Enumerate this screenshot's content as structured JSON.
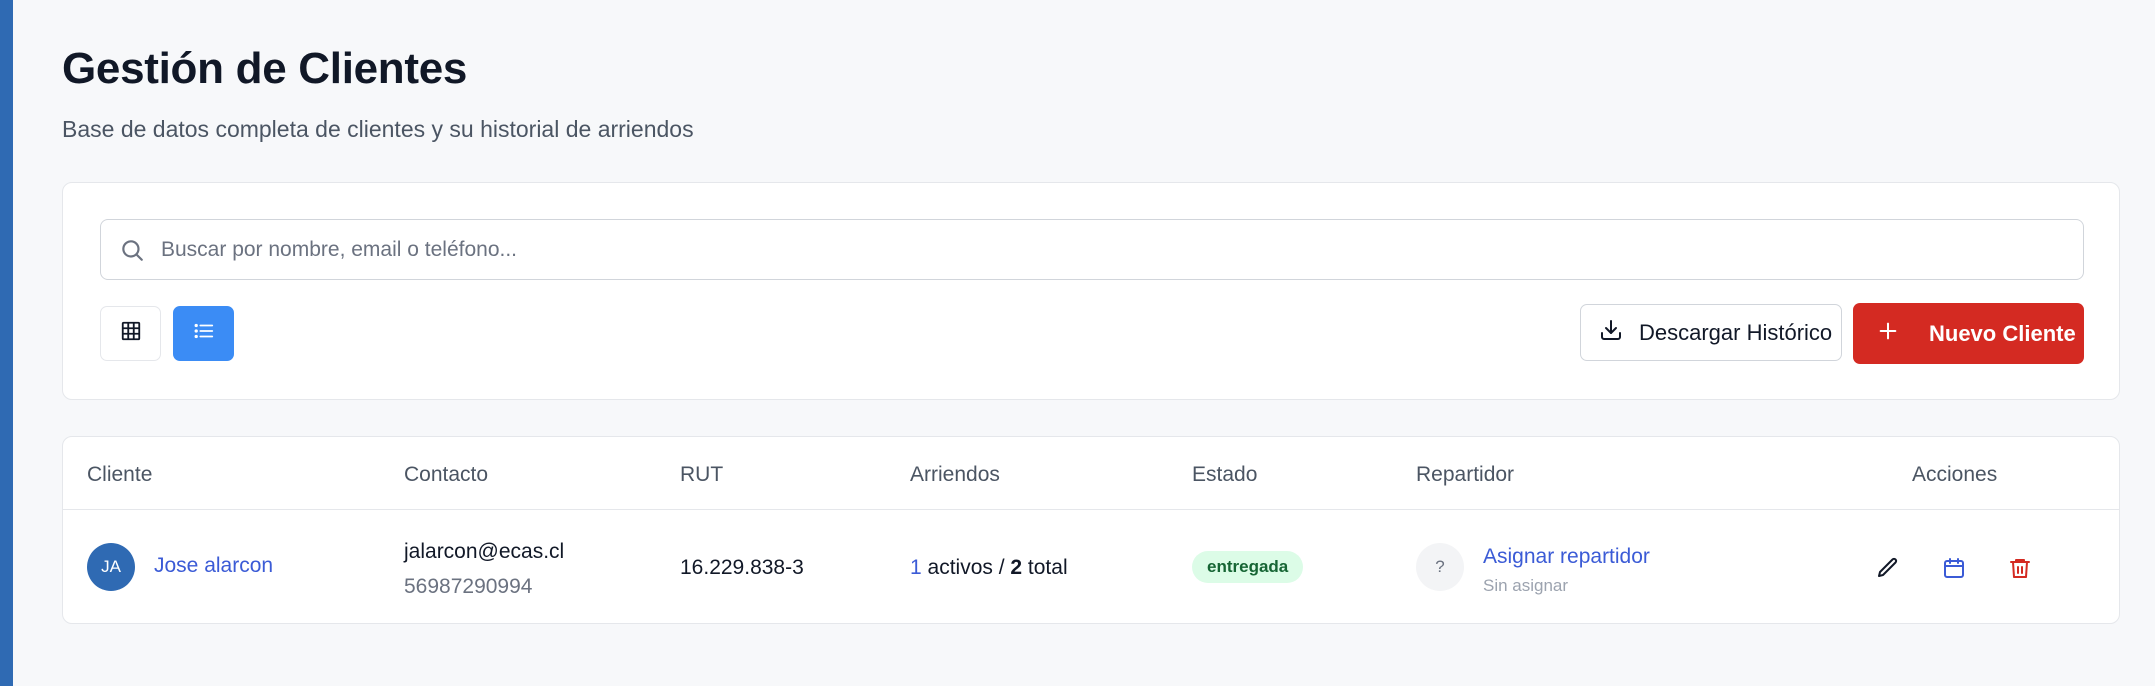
{
  "page": {
    "title": "Gestión de Clientes",
    "subtitle": "Base de datos completa de clientes y su historial de arriendos"
  },
  "toolbar": {
    "search": {
      "placeholder": "Buscar por nombre, email o teléfono...",
      "value": "",
      "icon": "search-icon"
    },
    "view_grid": {
      "icon": "grid-icon",
      "active": false
    },
    "view_list": {
      "icon": "list-icon",
      "active": true
    },
    "download_label": "Descargar Histórico",
    "download_icon": "download-icon",
    "new_client_label": "Nuevo Cliente",
    "new_client_icon": "plus-icon"
  },
  "table": {
    "headers": {
      "cliente": "Cliente",
      "contacto": "Contacto",
      "rut": "RUT",
      "arriendos": "Arriendos",
      "estado": "Estado",
      "repartidor": "Repartidor",
      "acciones": "Acciones"
    },
    "rows": [
      {
        "initials": "JA",
        "name": "Jose alarcon",
        "email": "jalarcon@ecas.cl",
        "phone": "56987290994",
        "rut": "16.229.838-3",
        "active_count": "1",
        "active_label": " activos / ",
        "total_count": "2",
        "total_label": " total",
        "status": "entregada",
        "distributor_avatar": "?",
        "assign_label": "Asignar repartidor",
        "assign_status": "Sin asignar",
        "actions": [
          "edit-icon",
          "calendar-icon",
          "trash-icon"
        ]
      }
    ]
  },
  "colors": {
    "accent_bar": "#2f6ab3",
    "primary_blue": "#3b8cf5",
    "danger_red": "#d42a22",
    "link_blue": "#3b5bd6",
    "status_green_bg": "#dcfce7",
    "status_green_text": "#166534"
  }
}
